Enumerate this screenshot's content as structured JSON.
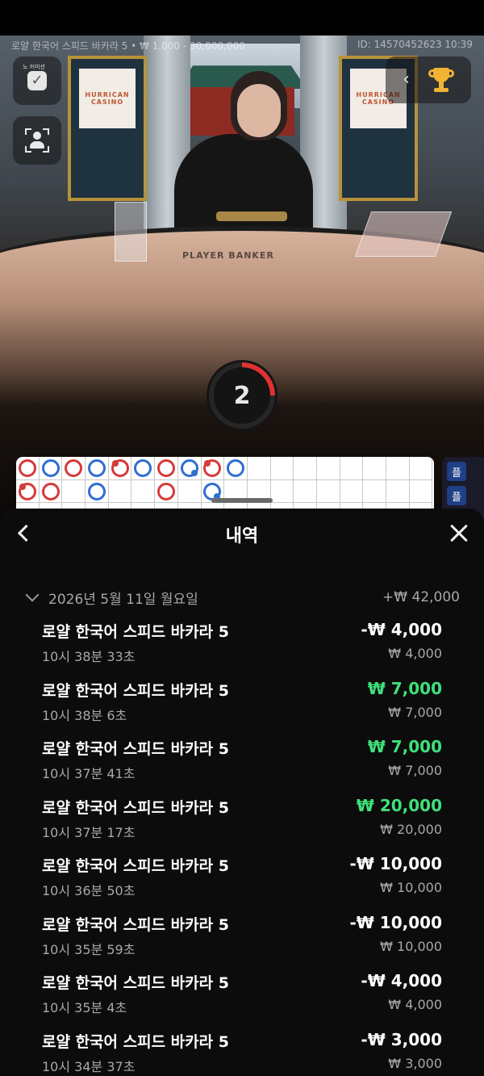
{
  "stream": {
    "table_info": "로얄 한국어 스피드 바카라 5 • ₩ 1,000 - 30,000,000",
    "game_id": "ID: 14570452623 10:39",
    "no_commission_label": "노 커미션",
    "table_text": "PLAYER  BANKER",
    "banner_text": "HURRICAN CASINO"
  },
  "timer": {
    "value": "2"
  },
  "roadmap": {
    "rows": [
      [
        "r",
        "b",
        "r",
        "b",
        "r-dot",
        "b",
        "r",
        "b-dot",
        "r-dot",
        "b",
        "",
        "",
        "",
        "",
        "",
        "",
        "",
        ""
      ],
      [
        "r-dot",
        "r",
        "",
        "b",
        "",
        "",
        "r",
        "",
        "b-dot",
        "",
        "",
        "",
        "",
        "",
        "",
        "",
        "",
        ""
      ]
    ],
    "side_chips": [
      "플",
      "플"
    ]
  },
  "history": {
    "title": "내역",
    "day": {
      "date": "2026년 5월 11일 월요일",
      "total": "+₩ 42,000"
    },
    "items": [
      {
        "name": "로얄 한국어 스피드 바카라 5",
        "time": "10시 38분 33초",
        "amount": "-₩ 4,000",
        "result": "loss",
        "stake": "₩ 4,000"
      },
      {
        "name": "로얄 한국어 스피드 바카라 5",
        "time": "10시 38분 6초",
        "amount": "₩ 7,000",
        "result": "win",
        "stake": "₩ 7,000"
      },
      {
        "name": "로얄 한국어 스피드 바카라 5",
        "time": "10시 37분 41초",
        "amount": "₩ 7,000",
        "result": "win",
        "stake": "₩ 7,000"
      },
      {
        "name": "로얄 한국어 스피드 바카라 5",
        "time": "10시 37분 17초",
        "amount": "₩ 20,000",
        "result": "win",
        "stake": "₩ 20,000"
      },
      {
        "name": "로얄 한국어 스피드 바카라 5",
        "time": "10시 36분 50초",
        "amount": "-₩ 10,000",
        "result": "loss",
        "stake": "₩ 10,000"
      },
      {
        "name": "로얄 한국어 스피드 바카라 5",
        "time": "10시 35분 59초",
        "amount": "-₩ 10,000",
        "result": "loss",
        "stake": "₩ 10,000"
      },
      {
        "name": "로얄 한국어 스피드 바카라 5",
        "time": "10시 35분 4초",
        "amount": "-₩ 4,000",
        "result": "loss",
        "stake": "₩ 4,000"
      },
      {
        "name": "로얄 한국어 스피드 바카라 5",
        "time": "10시 34분 37초",
        "amount": "-₩ 3,000",
        "result": "loss",
        "stake": "₩ 3,000"
      }
    ]
  },
  "colors": {
    "win": "#3fe07a",
    "loss": "#ffffff",
    "banker_red": "#d63a3a",
    "player_blue": "#2f6fcf",
    "timer_accent": "#e03131"
  },
  "icons": [
    "check-icon",
    "person-frame-icon",
    "chevron-left-icon",
    "trophy-icon",
    "back-chevron-icon",
    "close-icon",
    "chevron-down-icon"
  ]
}
